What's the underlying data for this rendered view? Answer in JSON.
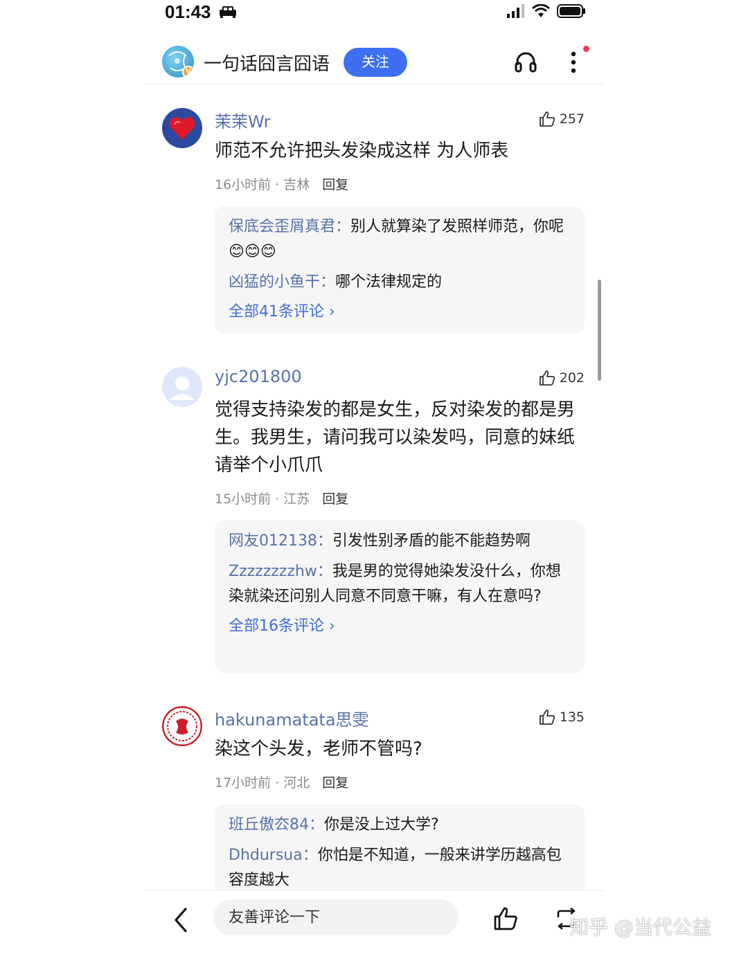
{
  "status_bar": {
    "time": "01:43"
  },
  "header": {
    "channel_name": "一句话囧言囧语",
    "follow_label": "关注",
    "verified_badge": "V"
  },
  "comments": [
    {
      "user": "茉茉Wr",
      "likes": "257",
      "text": "师范不允许把头发染成这样 为人师表",
      "time_location": "16小时前 · 吉林",
      "reply_label": "回复",
      "replies": [
        {
          "user": "保底会歪屑真君：",
          "text": "别人就算染了发照样师范，你呢😊😊😊"
        },
        {
          "user": "凶猛的小鱼干：",
          "text": "哪个法律规定的"
        }
      ],
      "all_replies": "全部41条评论 ›"
    },
    {
      "user": "yjc201800",
      "likes": "202",
      "text": "觉得支持染发的都是女生，反对染发的都是男生。我男生，请问我可以染发吗，同意的妹纸请举个小爪爪",
      "time_location": "15小时前 · 江苏",
      "reply_label": "回复",
      "replies": [
        {
          "user": "网友012138：",
          "text": "引发性别矛盾的能不能趋势啊"
        },
        {
          "user": "Zzzzzzzzhw：",
          "text": "我是男的觉得她染发没什么，你想染就染还问别人同意不同意干嘛，有人在意吗?"
        }
      ],
      "all_replies": "全部16条评论 ›"
    },
    {
      "user": "hakunamatata思雯",
      "likes": "135",
      "text": "染这个头发，老师不管吗?",
      "time_location": "17小时前 · 河北",
      "reply_label": "回复",
      "replies": [
        {
          "user": "班丘傲厺84：",
          "text": "你是没上过大学?"
        },
        {
          "user": "Dhdursua：",
          "text": "你怕是不知道，一般来讲学历越高包容度越大"
        }
      ]
    }
  ],
  "bottom_bar": {
    "input_placeholder": "友善评论一下"
  },
  "watermark": "知乎 @当代公益",
  "icons": [
    "car-icon",
    "signal-icon",
    "wifi-icon",
    "battery-icon",
    "headphone-icon",
    "more-icon",
    "thumbs-up-icon",
    "back-icon",
    "share-icon"
  ],
  "colors": {
    "accent": "#3d6ff0",
    "username": "#5872a8",
    "link": "#3d6fd6",
    "reply_bg": "#f6f6f6"
  }
}
